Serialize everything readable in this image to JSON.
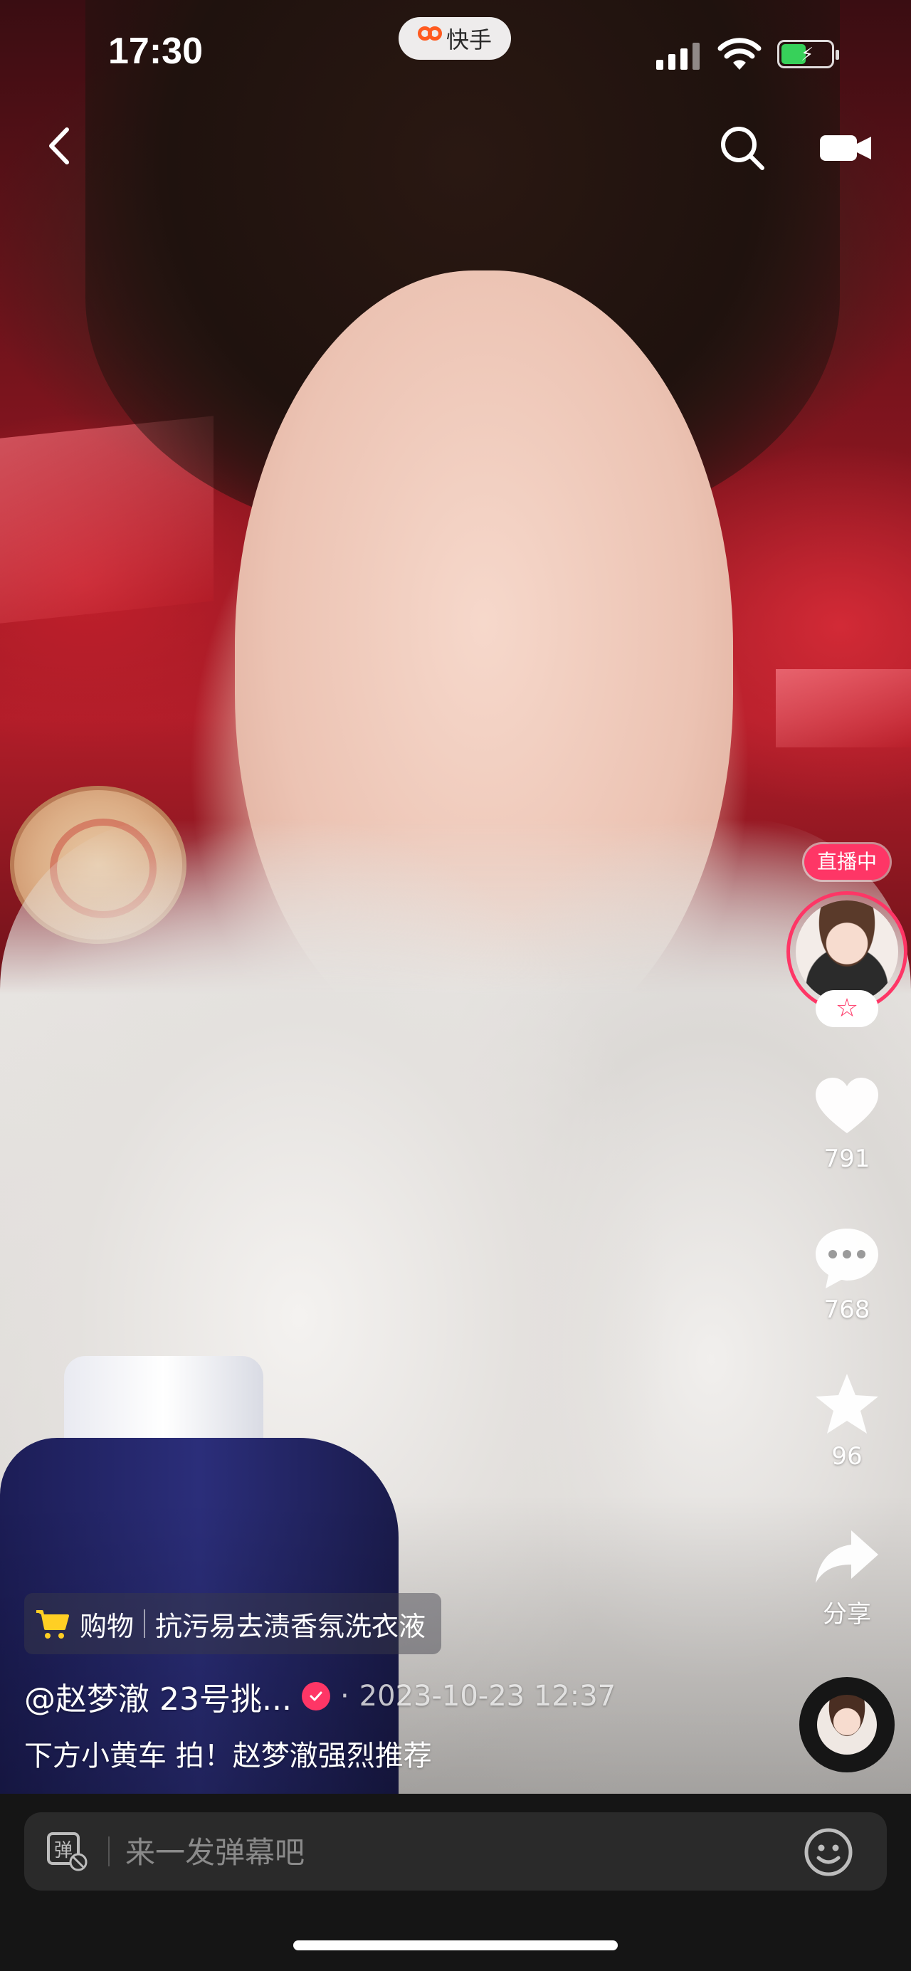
{
  "status_bar": {
    "time": "17:30",
    "app_name": "快手"
  },
  "right_rail": {
    "live_badge": "直播中",
    "follow_symbol": "☆",
    "likes": "791",
    "comments": "768",
    "favorites": "96",
    "share_label": "分享"
  },
  "product": {
    "tag": "购物",
    "name": "抗污易去渍香氛洗衣液"
  },
  "post": {
    "author": "@赵梦澈 23号挑...",
    "separator": "·",
    "time": "2023-10-23 12:37",
    "caption": "下方小黄车 拍！赵梦澈强烈推荐"
  },
  "danmaku": {
    "placeholder": "来一发弹幕吧",
    "toggle_label": "弹"
  },
  "colors": {
    "accent_pink": "#fe3666",
    "battery_green": "#37d15a",
    "cart_yellow": "#ffcf24",
    "bar_bg": "#2a2a2a"
  }
}
